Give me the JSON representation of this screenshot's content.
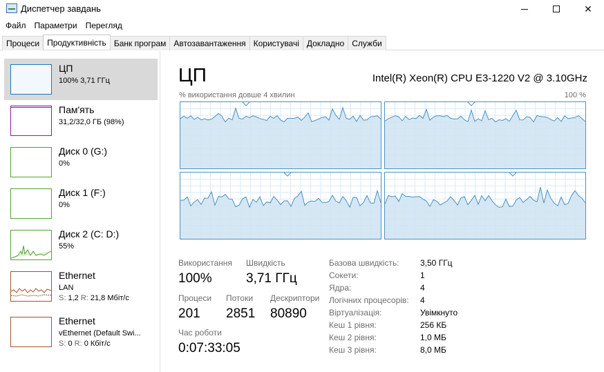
{
  "window": {
    "title": "Диспетчер завдань"
  },
  "menu": [
    "Файл",
    "Параметри",
    "Перегляд"
  ],
  "tabs": [
    "Процеси",
    "Продуктивність",
    "Банк програм",
    "Автозавантаження",
    "Користувачі",
    "Докладно",
    "Служби"
  ],
  "active_tab": "Продуктивність",
  "sidebar": {
    "items": [
      {
        "title": "ЦП",
        "line1": "100% 3,71 ГГц",
        "color": "#1a79bd"
      },
      {
        "title": "Пам'ять",
        "line1": "31,2/32,0 ГБ (98%)",
        "color": "#8b1a9a"
      },
      {
        "title": "Диск 0 (G:)",
        "line1": "0%",
        "color": "#4da32f"
      },
      {
        "title": "Диск 1 (F:)",
        "line1": "0%",
        "color": "#4da32f"
      },
      {
        "title": "Диск 2 (C: D:)",
        "line1": "55%",
        "color": "#4da32f"
      },
      {
        "title": "Ethernet",
        "line1": "LAN",
        "line2_s": "S:",
        "line2_s_val": "1,2",
        "line2_r": "R:",
        "line2_r_val": "21,8 Мбіт/с",
        "color": "#a0522d"
      },
      {
        "title": "Ethernet",
        "line1": "vEthernet (Default Swi...",
        "line2_s": "S:",
        "line2_s_val": "0",
        "line2_r": "R:",
        "line2_r_val": "0 Кбіт/с",
        "color": "#a0522d"
      }
    ]
  },
  "main": {
    "title": "ЦП",
    "cpu_model": "Intel(R) Xeon(R) CPU E3-1220 V2 @ 3.10GHz",
    "graph_label": "% використання довше 4 хвилин",
    "graph_max": "100 %",
    "stats": {
      "utilization_label": "Використання",
      "utilization": "100%",
      "speed_label": "Швидкість",
      "speed": "3,71 ГГц",
      "processes_label": "Процеси",
      "processes": "201",
      "threads_label": "Потоки",
      "threads": "2851",
      "handles_label": "Дескриптори",
      "handles": "80890",
      "uptime_label": "Час роботи",
      "uptime": "0:07:33:05"
    },
    "info": [
      {
        "label": "Базова швидкість:",
        "value": "3,50 ГГц"
      },
      {
        "label": "Сокети:",
        "value": "1"
      },
      {
        "label": "Ядра:",
        "value": "4"
      },
      {
        "label": "Логічних процесорів:",
        "value": "4"
      },
      {
        "label": "Віртуалізація:",
        "value": "Увімкнуто"
      },
      {
        "label": "Кеш 1 рівня:",
        "value": "256 КБ"
      },
      {
        "label": "Кеш 2 рівня:",
        "value": "1,0 МБ"
      },
      {
        "label": "Кеш 3 рівня:",
        "value": "8,0 МБ"
      }
    ]
  }
}
